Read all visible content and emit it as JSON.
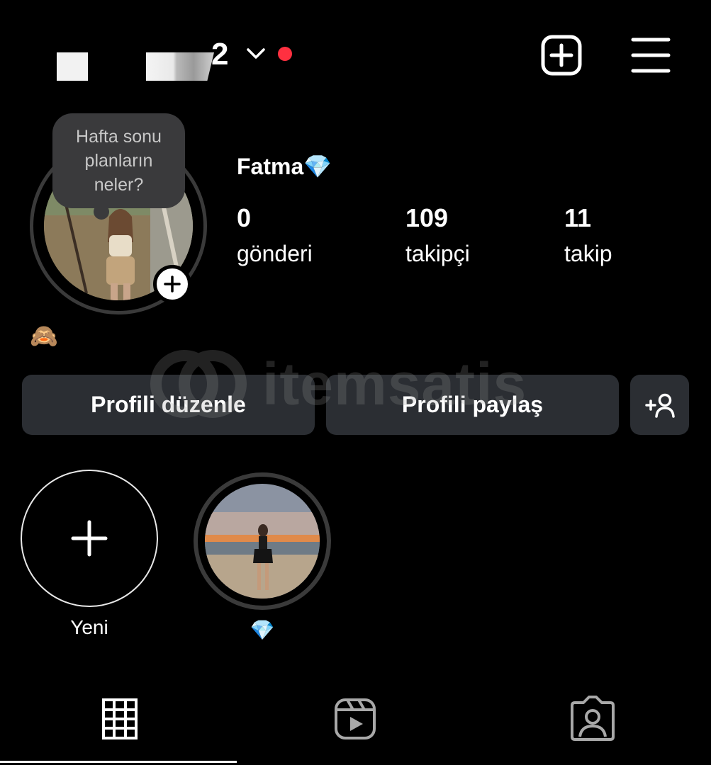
{
  "header": {
    "username_visible_suffix": "2",
    "has_notification": true,
    "accent_notification_color": "#ff3040",
    "icons": [
      "chevron-down-icon",
      "create-plus-icon",
      "hamburger-menu-icon"
    ]
  },
  "profile": {
    "note": "Hafta sonu planların neler?",
    "display_name": "Fatma💎",
    "bio": "🙈",
    "stats": [
      {
        "value": "0",
        "label": "gönderi"
      },
      {
        "value": "109",
        "label": "takipçi"
      },
      {
        "value": "11",
        "label": "takip"
      }
    ]
  },
  "actions": {
    "edit_profile": "Profili düzenle",
    "share_profile": "Profili paylaş",
    "discover_people_icon": "add-person-icon"
  },
  "watermark": {
    "text": "itemsatis"
  },
  "highlights": [
    {
      "label": "Yeni",
      "icon": "plus-icon"
    },
    {
      "label": "💎",
      "icon": "photo"
    }
  ],
  "tabs": [
    {
      "name": "grid",
      "icon": "grid-icon",
      "selected": true
    },
    {
      "name": "reels",
      "icon": "reels-icon",
      "selected": false
    },
    {
      "name": "tagged",
      "icon": "tagged-user-icon",
      "selected": false
    }
  ],
  "colors": {
    "background": "#000000",
    "button_bg": "#2b2e33",
    "note_bg": "#3a3a3c"
  }
}
